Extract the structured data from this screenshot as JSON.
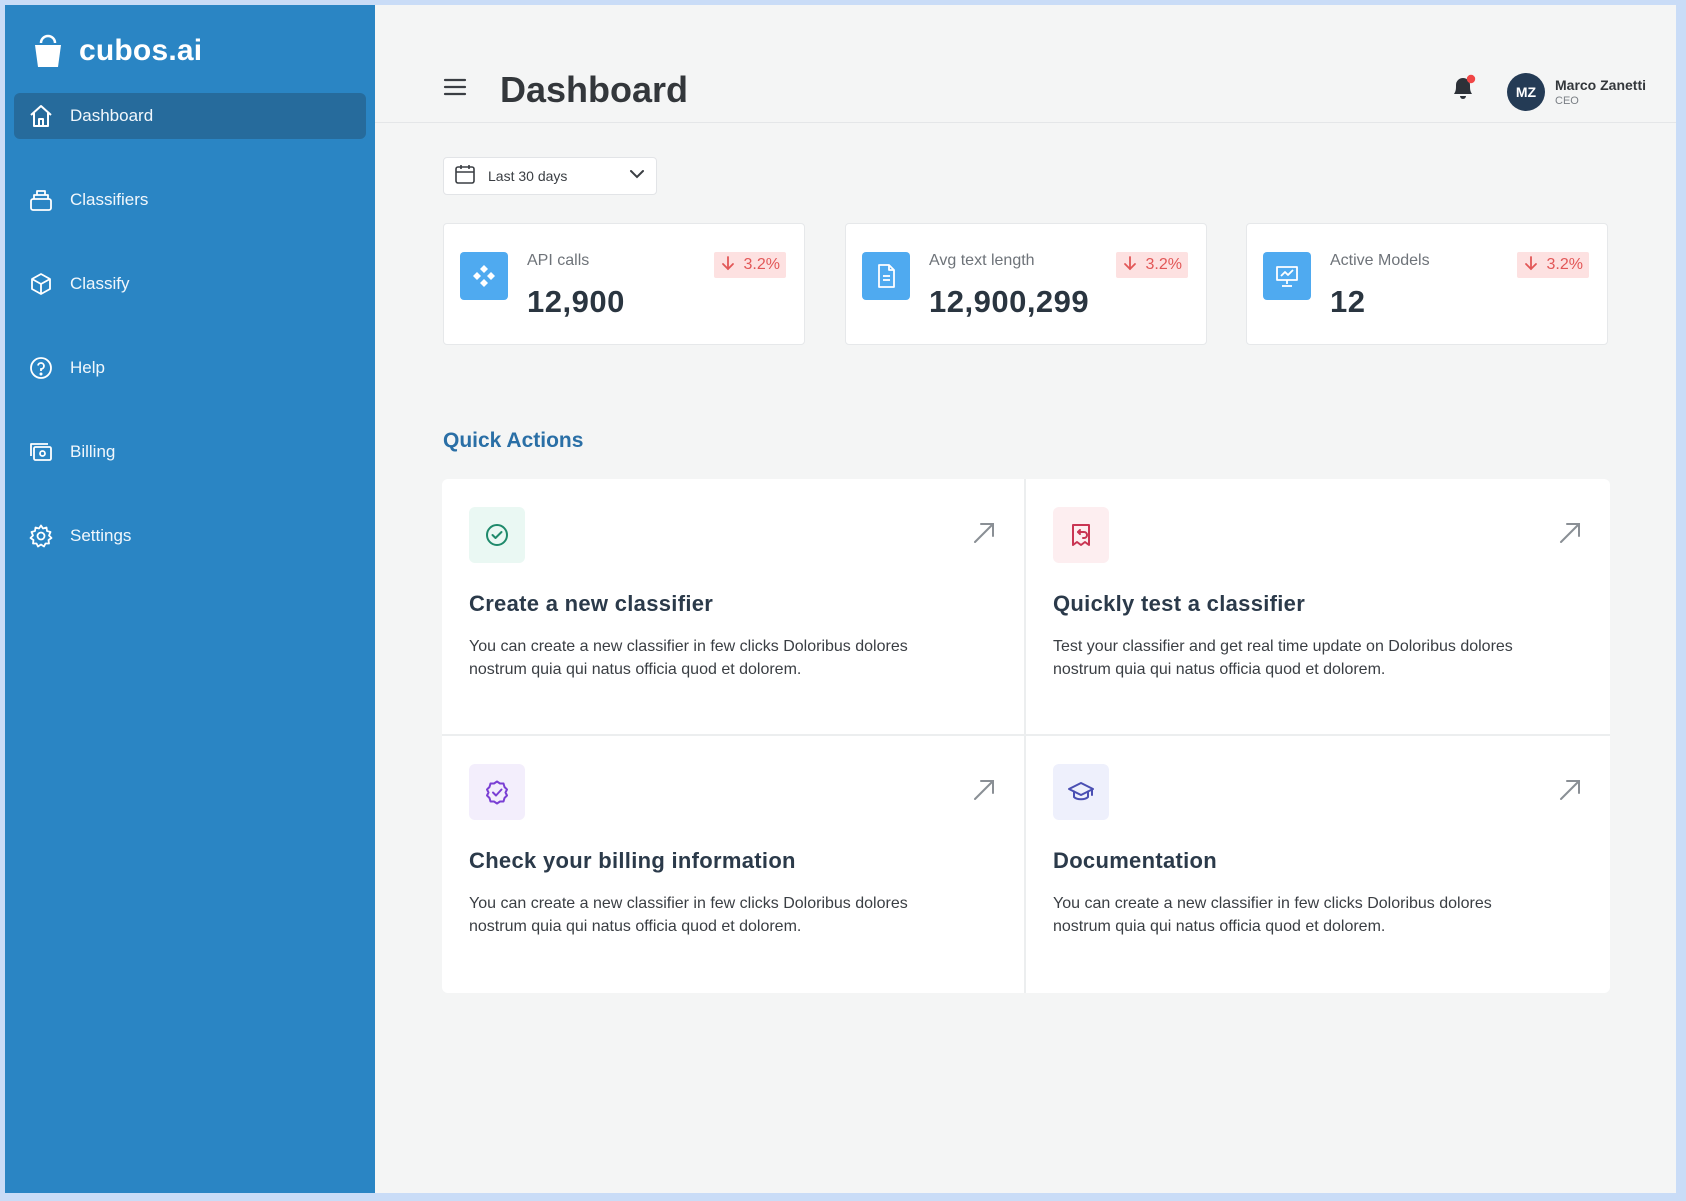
{
  "brand": {
    "name": "cubos.ai"
  },
  "sidebar": {
    "items": [
      {
        "label": "Dashboard",
        "icon": "home-icon",
        "active": true
      },
      {
        "label": "Classifiers",
        "icon": "stack-icon",
        "active": false
      },
      {
        "label": "Classify",
        "icon": "cube-icon",
        "active": false
      },
      {
        "label": "Help",
        "icon": "help-circle-icon",
        "active": false
      },
      {
        "label": "Billing",
        "icon": "billing-icon",
        "active": false
      },
      {
        "label": "Settings",
        "icon": "gear-icon",
        "active": false
      }
    ]
  },
  "header": {
    "title": "Dashboard",
    "user": {
      "initials": "MZ",
      "name": "Marco Zanetti",
      "role": "CEO"
    }
  },
  "filter": {
    "label": "Last 30 days"
  },
  "stats": [
    {
      "label": "API calls",
      "value": "12,900",
      "change": "3.2%",
      "icon": "api-icon"
    },
    {
      "label": "Avg text length",
      "value": "12,900,299",
      "change": "3.2%",
      "icon": "document-icon"
    },
    {
      "label": "Active Models",
      "value": "12",
      "change": "3.2%",
      "icon": "presentation-chart-icon"
    }
  ],
  "quick_actions": {
    "title": "Quick Actions",
    "items": [
      {
        "title": "Create a new classifier",
        "desc": "You can create a new classifier in few clicks Doloribus dolores nostrum quia qui natus officia quod et dolorem.",
        "icon": "check-circle-icon"
      },
      {
        "title": "Quickly test a classifier",
        "desc": "Test your classifier and get real time update on Doloribus dolores nostrum quia qui natus officia quod et dolorem.",
        "icon": "receipt-refund-icon"
      },
      {
        "title": "Check your billing information",
        "desc": "You can create a new classifier in few clicks Doloribus dolores nostrum quia qui natus officia quod et dolorem.",
        "icon": "badge-check-icon"
      },
      {
        "title": "Documentation",
        "desc": "You can create a new classifier in few clicks Doloribus dolores nostrum quia qui natus officia quod et dolorem.",
        "icon": "academic-cap-icon"
      }
    ]
  },
  "colors": {
    "sidebar": "#2a85c4",
    "sidebar_active": "#266b9c",
    "accent": "#4faaf0",
    "negative": "#e25757",
    "section_title": "#2a6fa6"
  }
}
